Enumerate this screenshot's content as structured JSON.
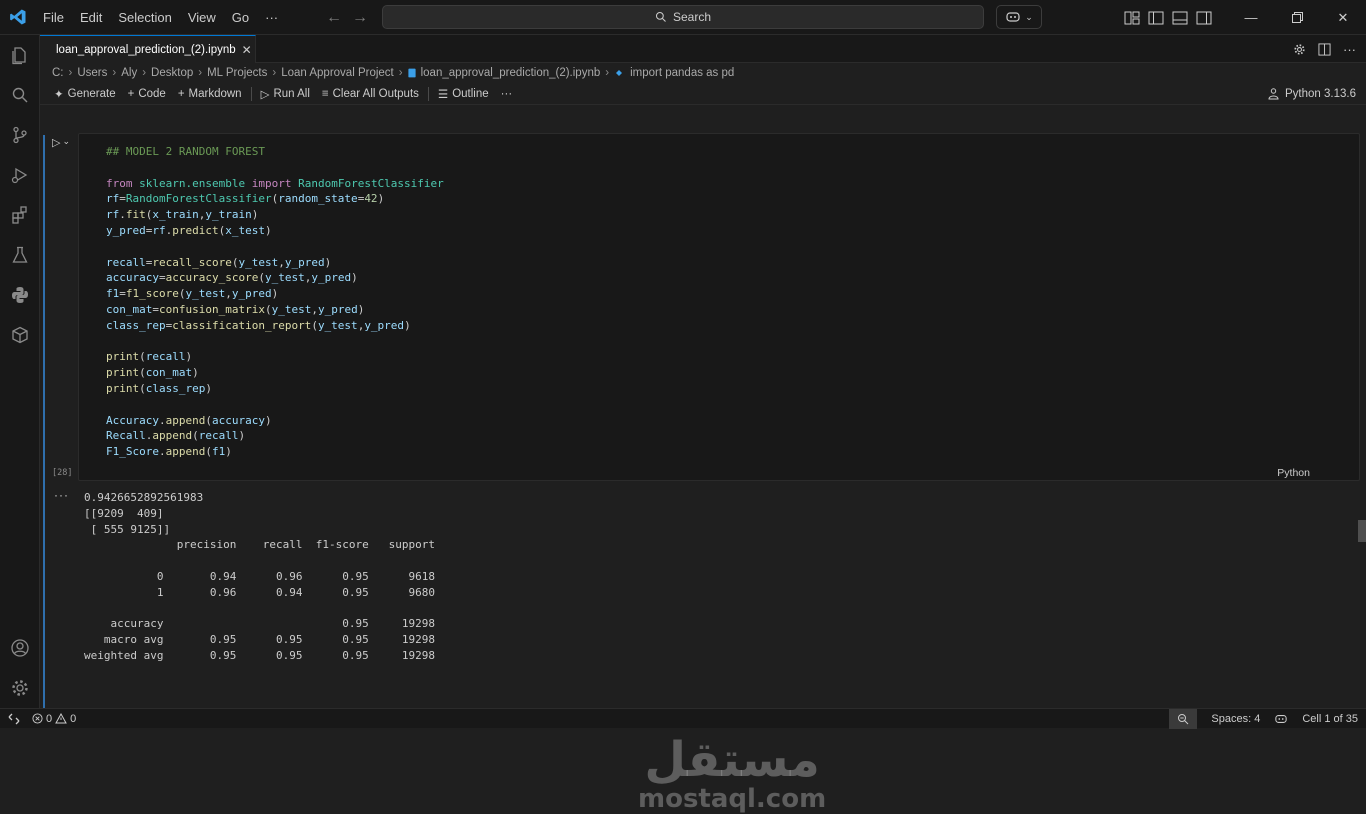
{
  "menu": [
    "File",
    "Edit",
    "Selection",
    "View",
    "Go",
    "···"
  ],
  "search": {
    "label": "Search"
  },
  "tab": {
    "label": "loan_approval_prediction_(2).ipynb"
  },
  "breadcrumb": [
    "C:",
    "Users",
    "Aly",
    "Desktop",
    "ML Projects",
    "Loan Approval Project",
    "loan_approval_prediction_(2).ipynb",
    "import pandas as pd"
  ],
  "toolbar": {
    "generate": "Generate",
    "code": "Code",
    "markdown": "Markdown",
    "run_all": "Run All",
    "clear_outputs": "Clear All Outputs",
    "outline": "Outline",
    "more": "···",
    "kernel": "Python 3.13.6"
  },
  "cell": {
    "execution_count": "[28]",
    "language": "Python",
    "code_lines": [
      "## MODEL 2 RANDOM FOREST",
      "",
      "from sklearn.ensemble import RandomForestClassifier",
      "rf=RandomForestClassifier(random_state=42)",
      "rf.fit(x_train,y_train)",
      "y_pred=rf.predict(x_test)",
      "",
      "recall=recall_score(y_test,y_pred)",
      "accuracy=accuracy_score(y_test,y_pred)",
      "f1=f1_score(y_test,y_pred)",
      "con_mat=confusion_matrix(y_test,y_pred)",
      "class_rep=classification_report(y_test,y_pred)",
      "",
      "print(recall)",
      "print(con_mat)",
      "print(class_rep)",
      "",
      "Accuracy.append(accuracy)",
      "Recall.append(recall)",
      "F1_Score.append(f1)"
    ],
    "output_marker": "···",
    "output_lines": [
      "0.9426652892561983",
      "[[9209  409]",
      " [ 555 9125]]",
      "              precision    recall  f1-score   support",
      "",
      "           0       0.94      0.96      0.95      9618",
      "           1       0.96      0.94      0.95      9680",
      "",
      "    accuracy                           0.95     19298",
      "   macro avg       0.95      0.95      0.95     19298",
      "weighted avg       0.95      0.95      0.95     19298"
    ]
  },
  "watermark": {
    "arabic": "مستقل",
    "latin": "mostaql.com"
  },
  "status": {
    "errors": "0",
    "warnings": "0",
    "spaces": "Spaces: 4",
    "cell_position": "Cell 1 of 35"
  },
  "colors": {
    "accent": "#0078d4",
    "background": "#1f1f1f",
    "chrome": "#181818"
  }
}
